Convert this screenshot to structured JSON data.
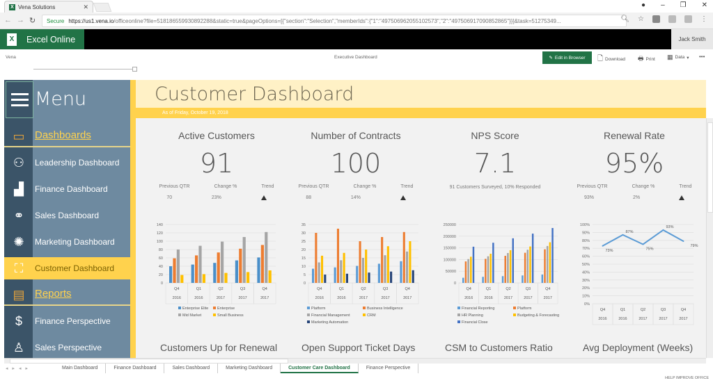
{
  "browser": {
    "tab_title": "Vena Solutions",
    "secure_label": "Secure",
    "url_domain": "https://us1.vena.io",
    "url_rest": "/officeonline?file=518186559930892288&static=true&pageOptions=[{\"section\":\"Selection\",\"memberIds\":{\"1\":\"497506962055102573\",\"2\":\"497506917090852865\"}}]&task=51275349..."
  },
  "excel": {
    "app_name": "Excel Online",
    "user": "Jack Smith",
    "breadcrumb_left": "Vena",
    "workbook_title": "Executive Dashboard",
    "edit_label": "Edit in Browser",
    "download_label": "Download",
    "print_label": "Print",
    "data_label": "Data",
    "more_label": "•••",
    "accent": "#217346"
  },
  "sidebar": {
    "menu_label": "Menu",
    "items": [
      {
        "label": "Dashboards",
        "icon": "presentation-icon",
        "type": "section"
      },
      {
        "label": "Leadership Dashboard",
        "icon": "team-meeting-icon"
      },
      {
        "label": "Finance Dashboard",
        "icon": "growth-chart-icon"
      },
      {
        "label": "Sales Dashboard",
        "icon": "handshake-icon"
      },
      {
        "label": "Marketing Dashboard",
        "icon": "lightbulb-icon"
      },
      {
        "label": "Customer Dashboard",
        "icon": "org-chart-icon",
        "active": true
      },
      {
        "label": "Reports",
        "icon": "clipboard-icon",
        "type": "section"
      },
      {
        "label": "Finance Perspective",
        "icon": "money-hand-icon"
      },
      {
        "label": "Sales Perspective",
        "icon": "people-icon"
      }
    ]
  },
  "dashboard": {
    "title": "Customer Dashboard",
    "as_of": "As of Friday, October 19, 2018",
    "kpis": [
      {
        "title": "Active Customers",
        "value": "91",
        "prev_label": "Previous QTR",
        "change_label": "Change %",
        "trend_label": "Trend",
        "prev": "70",
        "change": "23%",
        "trend": "up"
      },
      {
        "title": "Number of Contracts",
        "value": "100",
        "prev_label": "Previous QTR",
        "change_label": "Change %",
        "trend_label": "Trend",
        "prev": "88",
        "change": "14%",
        "trend": "up"
      },
      {
        "title": "NPS Score",
        "value": "7.1",
        "note": "91 Customers Surveyed, 10% Responded"
      },
      {
        "title": "Renewal Rate",
        "value": "95%",
        "prev_label": "Previous QTR",
        "change_label": "Change %",
        "trend_label": "Trend",
        "prev": "93%",
        "change": "2%",
        "trend": "up"
      }
    ],
    "bottom_titles": [
      "Customers Up for Renewal",
      "Open Support Ticket Days",
      "CSM to Customers Ratio",
      "Avg Deployment (Weeks)"
    ]
  },
  "chart_data": [
    {
      "type": "bar",
      "categories": [
        [
          "Q4",
          "2016"
        ],
        [
          "Q1",
          "2016"
        ],
        [
          "Q2",
          "2017"
        ],
        [
          "Q3",
          "2017"
        ],
        [
          "Q4",
          "2017"
        ]
      ],
      "ylim": [
        0,
        140
      ],
      "yticks": [
        0,
        20,
        40,
        60,
        80,
        100,
        120,
        140
      ],
      "series": [
        {
          "name": "Enterprise Elite",
          "color": "#4a8fc9",
          "values": [
            40,
            44,
            48,
            54,
            61
          ]
        },
        {
          "name": "Enterprise",
          "color": "#ed7d31",
          "values": [
            59,
            66,
            73,
            82,
            91
          ]
        },
        {
          "name": "Mid Market",
          "color": "#a5a5a5",
          "values": [
            80,
            89,
            99,
            110,
            122
          ]
        },
        {
          "name": "Small Business",
          "color": "#ffc000",
          "values": [
            19,
            21,
            24,
            26,
            30
          ]
        }
      ]
    },
    {
      "type": "bar",
      "categories": [
        [
          "Q4",
          "2016"
        ],
        [
          "Q1",
          "2016"
        ],
        [
          "Q2",
          "2017"
        ],
        [
          "Q3",
          "2017"
        ],
        [
          "Q4",
          "2017"
        ]
      ],
      "ylim": [
        0,
        35
      ],
      "yticks": [
        0,
        5,
        10,
        15,
        20,
        25,
        30,
        35
      ],
      "series": [
        {
          "name": "Platform",
          "color": "#5b9bd5",
          "values": [
            8.5,
            9.3,
            10.2,
            11.5,
            13
          ]
        },
        {
          "name": "Business Intelligence",
          "color": "#ed7d31",
          "values": [
            30,
            32.5,
            25,
            27.5,
            30.5
          ]
        },
        {
          "name": "Financial Management",
          "color": "#a5a5a5",
          "values": [
            12.3,
            13.6,
            15,
            16.6,
            18.8
          ]
        },
        {
          "name": "CRM",
          "color": "#ffc000",
          "values": [
            16.3,
            18,
            20,
            22,
            25
          ]
        },
        {
          "name": "Marketing Automation",
          "color": "#264478",
          "values": [
            5,
            5.5,
            6.2,
            6.8,
            7.6
          ]
        }
      ]
    },
    {
      "type": "bar",
      "categories": [
        [
          "Q4",
          "2016"
        ],
        [
          "Q1",
          "2016"
        ],
        [
          "Q2",
          "2017"
        ],
        [
          "Q3",
          "2017"
        ],
        [
          "Q4",
          "2017"
        ]
      ],
      "ylim": [
        0,
        250000
      ],
      "yticks": [
        0,
        50000,
        100000,
        150000,
        200000,
        250000
      ],
      "series": [
        {
          "name": "Financial Reporting",
          "color": "#5b9bd5",
          "values": [
            22000,
            26000,
            29000,
            32000,
            36000
          ]
        },
        {
          "name": "Platform",
          "color": "#ed7d31",
          "values": [
            92000,
            103000,
            116000,
            129000,
            144000
          ]
        },
        {
          "name": "HR Planning",
          "color": "#a5a5a5",
          "values": [
            102000,
            114000,
            128000,
            142000,
            158000
          ]
        },
        {
          "name": "Budgeting & Forecasting",
          "color": "#ffc000",
          "values": [
            112000,
            125000,
            140000,
            156000,
            174000
          ]
        },
        {
          "name": "Financial Close",
          "color": "#4472c4",
          "values": [
            155000,
            172000,
            191000,
            211000,
            235000
          ]
        }
      ]
    },
    {
      "type": "line",
      "categories": [
        [
          "Q4",
          "2016"
        ],
        [
          "Q1",
          "2016"
        ],
        [
          "Q2",
          "2017"
        ],
        [
          "Q3",
          "2017"
        ],
        [
          "Q4",
          "2017"
        ]
      ],
      "ylim": [
        0,
        100
      ],
      "yticks": [
        0,
        10,
        20,
        30,
        40,
        50,
        60,
        70,
        80,
        90,
        100
      ],
      "ytick_suffix": "%",
      "series": [
        {
          "name": "Renewal Rate",
          "color": "#5b9bd5",
          "values": [
            73,
            87,
            75,
            93,
            79
          ]
        }
      ]
    }
  ],
  "sheet_tabs": [
    {
      "label": "Main Dashboard"
    },
    {
      "label": "Finance Dashboard"
    },
    {
      "label": "Sales Dashboard"
    },
    {
      "label": "Marketing Dashboard"
    },
    {
      "label": "Customer Care Dashboard",
      "active": true
    },
    {
      "label": "Finance Perspective"
    }
  ],
  "status": {
    "help_label": "HELP IMPROVE OFFICE"
  }
}
